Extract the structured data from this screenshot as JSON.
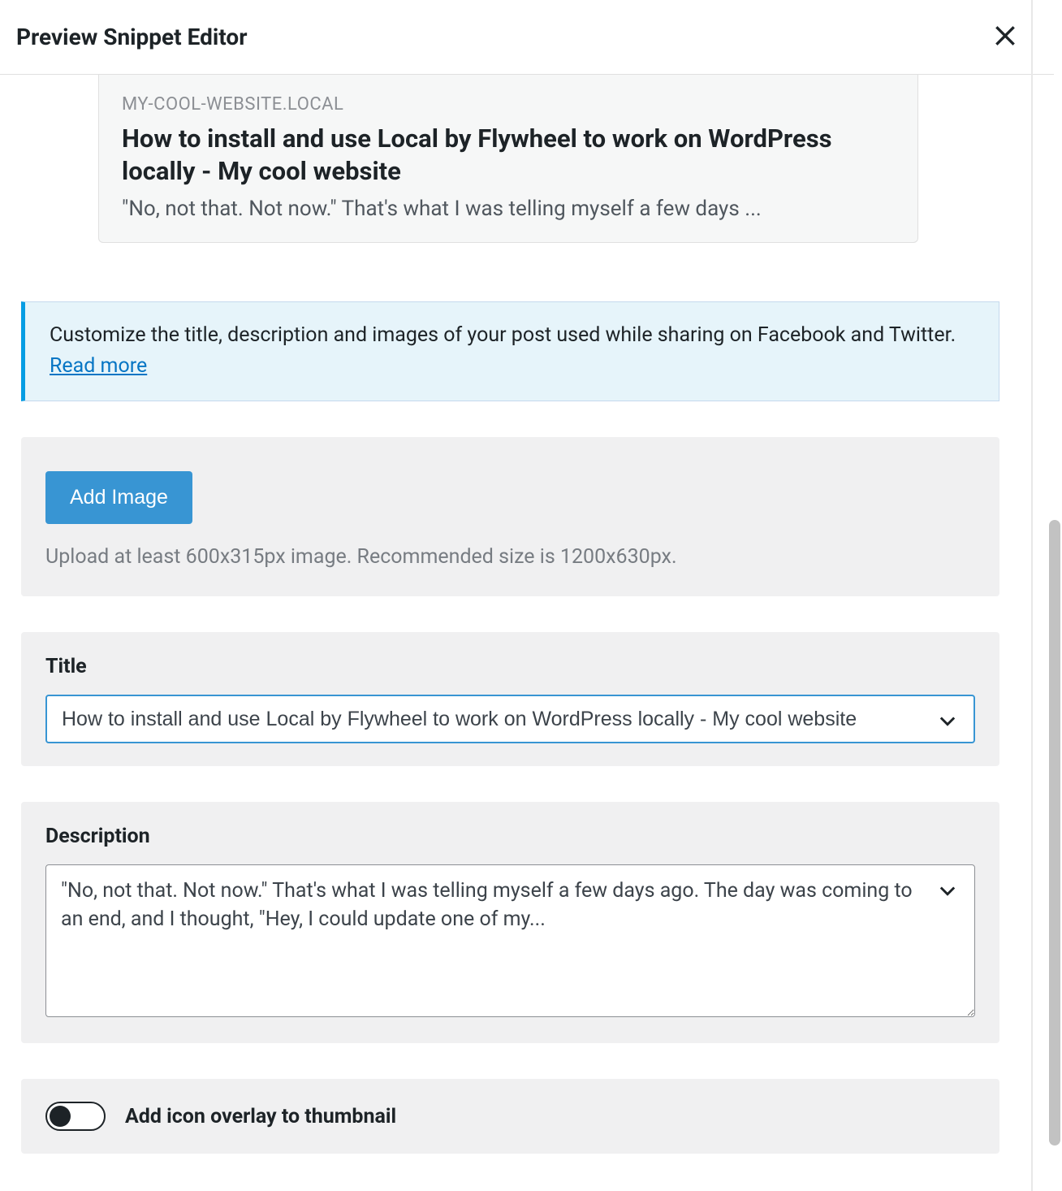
{
  "modal": {
    "title": "Preview Snippet Editor"
  },
  "preview": {
    "domain": "MY-COOL-WEBSITE.LOCAL",
    "title": "How to install and use Local by Flywheel to work on WordPress locally - My cool website",
    "description": "\"No, not that. Not now.\" That's what I was telling myself a few days ..."
  },
  "notice": {
    "text_before": "Customize the title, description and images of your post used while sharing on Facebook and Twitter. ",
    "link_label": "Read more"
  },
  "image_section": {
    "button_label": "Add Image",
    "helper": "Upload at least 600x315px image. Recommended size is 1200x630px."
  },
  "title_field": {
    "label": "Title",
    "value": "How to install and use Local by Flywheel to work on WordPress locally - My cool website"
  },
  "description_field": {
    "label": "Description",
    "value": "\"No, not that. Not now.\" That's what I was telling myself a few days ago. The day was coming to an end, and I thought, \"Hey, I could update one of my..."
  },
  "overlay_toggle": {
    "label": "Add icon overlay to thumbnail",
    "checked": false
  }
}
